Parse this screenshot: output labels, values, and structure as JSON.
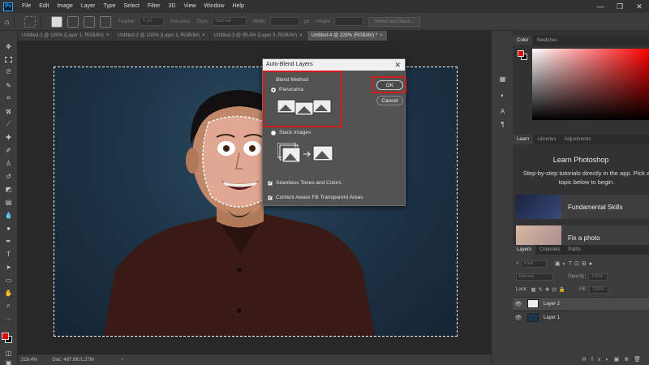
{
  "menubar": {
    "app_icon": "Ps",
    "items": [
      "File",
      "Edit",
      "Image",
      "Layer",
      "Type",
      "Select",
      "Filter",
      "3D",
      "View",
      "Window",
      "Help"
    ],
    "win_controls": [
      "—",
      "❐",
      "✕"
    ]
  },
  "options_bar": {
    "feather_label": "Feather:",
    "feather_value": "0 px",
    "antialias_label": "Anti-alias",
    "style_label": "Style:",
    "style_value": "Normal",
    "width_label": "Width:",
    "height_label": "Height:",
    "select_mask_label": "Select and Mask..."
  },
  "tabs": [
    {
      "label": "Untitled-1 @ 180% (Layer 1, RGB/8#)",
      "active": false
    },
    {
      "label": "Untitled-2 @ 100% (Layer 1, RGB/8#)",
      "active": false
    },
    {
      "label": "Untitled-3 @ 95.4% (Layer 3, RGB/8#)",
      "active": false
    },
    {
      "label": "Untitled-4 @ 228% (RGB/8#) *",
      "active": true
    }
  ],
  "tab_close": "×",
  "status_bar": {
    "zoom": "228.4%",
    "doc": "Doc: 487.8K/1.27M",
    "arrow": "›"
  },
  "dialog": {
    "title": "Auto-Blend Layers",
    "close": "✕",
    "group_label": "Blend Method",
    "options": [
      {
        "label": "Panorama",
        "selected": true
      },
      {
        "label": "Stack Images",
        "selected": false
      }
    ],
    "checkboxes": [
      {
        "label": "Seamless Tones and Colors",
        "checked": true
      },
      {
        "label": "Content Aware Fill Transparent Areas",
        "checked": true
      }
    ],
    "ok_label": "OK",
    "cancel_label": "Cancel",
    "highlight_color": "#d11a1a"
  },
  "color_panel": {
    "tabs": [
      "Color",
      "Swatches"
    ],
    "foreground": "#e20000",
    "background": "#000000"
  },
  "learn_panel": {
    "tabs": [
      "Learn",
      "Libraries",
      "Adjustments"
    ],
    "title": "Learn Photoshop",
    "subtitle": "Step-by-step tutorials directly in the app. Pick a topic below to begin.",
    "cards": [
      {
        "label": "Fundamental Skills"
      },
      {
        "label": "Fix a photo"
      }
    ]
  },
  "layers_panel": {
    "tabs": [
      "Layers",
      "Channels",
      "Paths"
    ],
    "kind_placeholder": "Kind",
    "blend_mode": "Normal",
    "opacity_label": "Opacity:",
    "opacity_value": "100%",
    "lock_label": "Lock:",
    "fill_label": "Fill:",
    "fill_value": "100%",
    "layers": [
      {
        "name": "Layer 2",
        "visible": true
      },
      {
        "name": "Layer 1",
        "visible": true
      }
    ]
  },
  "toolbar_icons": [
    "move-icon",
    "marquee-icon",
    "lasso-icon",
    "quick-select-icon",
    "crop-icon",
    "frame-icon",
    "eyedropper-icon",
    "healing-icon",
    "brush-icon",
    "stamp-icon",
    "history-brush-icon",
    "eraser-icon",
    "gradient-icon",
    "blur-icon",
    "dodge-icon",
    "pen-icon",
    "type-icon",
    "path-select-icon",
    "rectangle-icon",
    "hand-icon",
    "zoom-icon",
    "more-icon"
  ]
}
